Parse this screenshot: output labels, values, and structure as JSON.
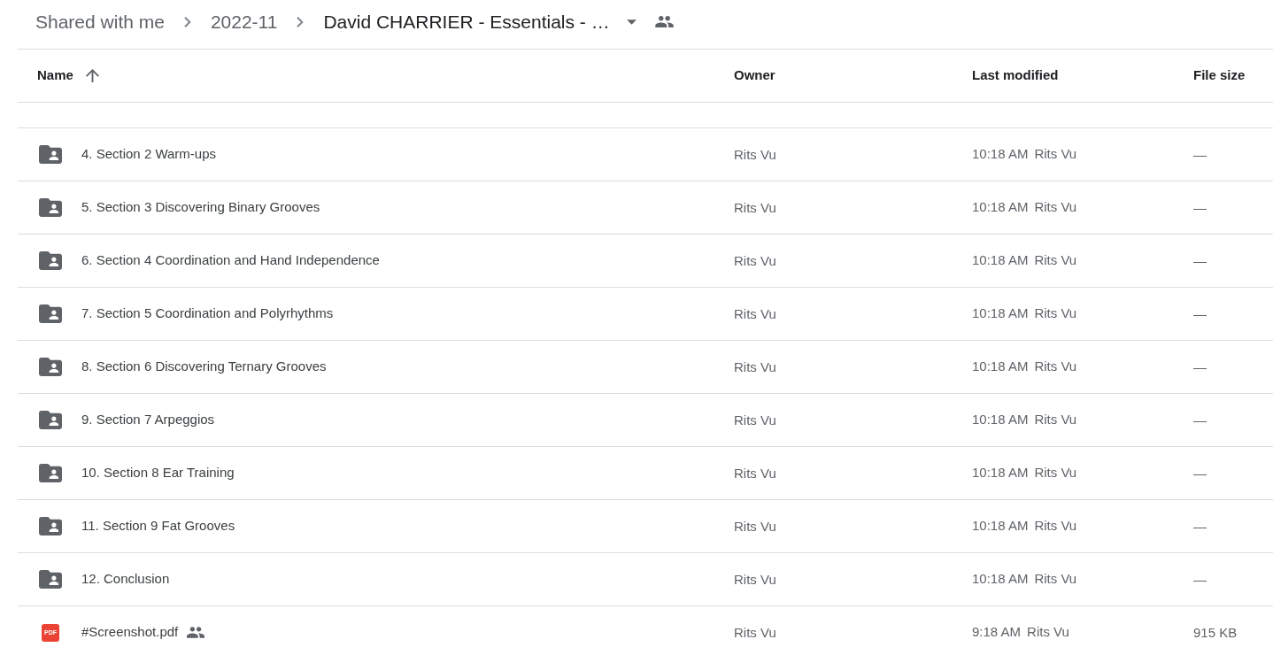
{
  "breadcrumb": [
    {
      "label": "Shared with me",
      "current": false,
      "has_menu": false,
      "shared": false
    },
    {
      "label": "2022-11",
      "current": false,
      "has_menu": false,
      "shared": false
    },
    {
      "label": "David CHARRIER - Essentials - …",
      "current": true,
      "has_menu": true,
      "shared": true
    }
  ],
  "table": {
    "columns": [
      {
        "label": "Name",
        "sorted": true
      },
      {
        "label": "Owner",
        "sorted": false
      },
      {
        "label": "Last modified",
        "sorted": false
      },
      {
        "label": "File size",
        "sorted": false
      }
    ],
    "rows": [
      {
        "kind": "shared-folder",
        "name": "4. Section 2 Warm-ups",
        "shared": false,
        "owner": "Rits Vu",
        "modified_time": "10:18 AM",
        "modified_by": "Rits Vu",
        "size": "—"
      },
      {
        "kind": "shared-folder",
        "name": "5. Section 3 Discovering Binary Grooves",
        "shared": false,
        "owner": "Rits Vu",
        "modified_time": "10:18 AM",
        "modified_by": "Rits Vu",
        "size": "—"
      },
      {
        "kind": "shared-folder",
        "name": "6. Section 4 Coordination and Hand Independence",
        "shared": false,
        "owner": "Rits Vu",
        "modified_time": "10:18 AM",
        "modified_by": "Rits Vu",
        "size": "—"
      },
      {
        "kind": "shared-folder",
        "name": "7. Section 5 Coordination and Polyrhythms",
        "shared": false,
        "owner": "Rits Vu",
        "modified_time": "10:18 AM",
        "modified_by": "Rits Vu",
        "size": "—"
      },
      {
        "kind": "shared-folder",
        "name": "8. Section 6 Discovering Ternary Grooves",
        "shared": false,
        "owner": "Rits Vu",
        "modified_time": "10:18 AM",
        "modified_by": "Rits Vu",
        "size": "—"
      },
      {
        "kind": "shared-folder",
        "name": "9. Section 7 Arpeggios",
        "shared": false,
        "owner": "Rits Vu",
        "modified_time": "10:18 AM",
        "modified_by": "Rits Vu",
        "size": "—"
      },
      {
        "kind": "shared-folder",
        "name": "10. Section 8 Ear Training",
        "shared": false,
        "owner": "Rits Vu",
        "modified_time": "10:18 AM",
        "modified_by": "Rits Vu",
        "size": "—"
      },
      {
        "kind": "shared-folder",
        "name": "11. Section 9 Fat Grooves",
        "shared": false,
        "owner": "Rits Vu",
        "modified_time": "10:18 AM",
        "modified_by": "Rits Vu",
        "size": "—"
      },
      {
        "kind": "shared-folder",
        "name": "12. Conclusion",
        "shared": false,
        "owner": "Rits Vu",
        "modified_time": "10:18 AM",
        "modified_by": "Rits Vu",
        "size": "—"
      },
      {
        "kind": "pdf",
        "badge": "PDF",
        "name": "#Screenshot.pdf",
        "shared": true,
        "owner": "Rits Vu",
        "modified_time": "9:18 AM",
        "modified_by": "Rits Vu",
        "size": "915 KB"
      }
    ]
  }
}
